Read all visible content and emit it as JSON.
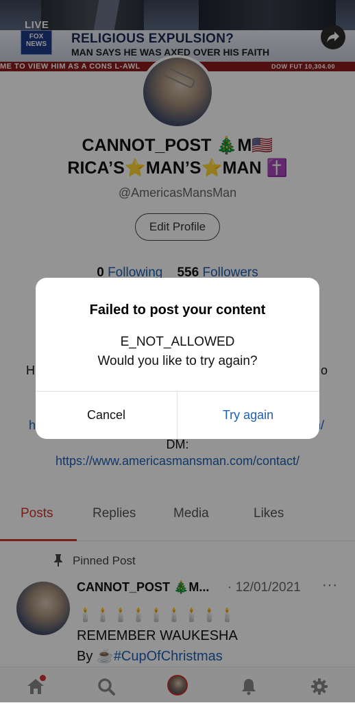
{
  "banner": {
    "live": "LIVE",
    "network": "FOX NEWS",
    "headline": "RELIGIOUS EXPULSION?",
    "subline": "MAN SAYS HE WAS AXED OVER HIS FAITH",
    "ticker": "ME TO VIEW HIM AS A CONS      L-AWL",
    "dow": "DOW FUT   10,304.00"
  },
  "profile": {
    "display_name_line1": "CANNOT_POST 🎄M🇺🇸",
    "display_name_line2": "RICA’S⭐MAN’S⭐MAN ✝️",
    "handle": "@AmericasMansMan",
    "edit_profile": "Edit Profile",
    "following_count": "0",
    "following_label": "Following",
    "followers_count": "556",
    "followers_label": "Followers",
    "bio_fragment_left": "H",
    "bio_fragment_right": "o",
    "bio_link_left": "h",
    "bio_link_right": "n/",
    "dm_label": "DM:",
    "dm_link": "https://www.americasmansman.com/contact/"
  },
  "tabs": [
    {
      "label": "Posts",
      "active": true
    },
    {
      "label": "Replies",
      "active": false
    },
    {
      "label": "Media",
      "active": false
    },
    {
      "label": "Likes",
      "active": false
    }
  ],
  "post": {
    "pinned_label": "Pinned Post",
    "author": "CANNOT_POST 🎄M...",
    "date": "· 12/01/2021",
    "more": "···",
    "candles": "🕯️🕯️🕯️🕯️🕯️🕯️🕯️🕯️🕯️",
    "line1": "REMEMBER WAUKESHA",
    "by": "By ☕",
    "hashtag": "#CupOfChristmas"
  },
  "bottom_nav": [
    "home-icon",
    "search-icon",
    "profile-avatar",
    "bell-icon",
    "gear-icon"
  ],
  "dialog": {
    "title": "Failed to post your content",
    "code": "E_NOT_ALLOWED",
    "question": "Would you like to try again?",
    "cancel": "Cancel",
    "try_again": "Try again"
  },
  "colors": {
    "accent_red": "#d0342c",
    "link_blue": "#1d5fb4"
  }
}
